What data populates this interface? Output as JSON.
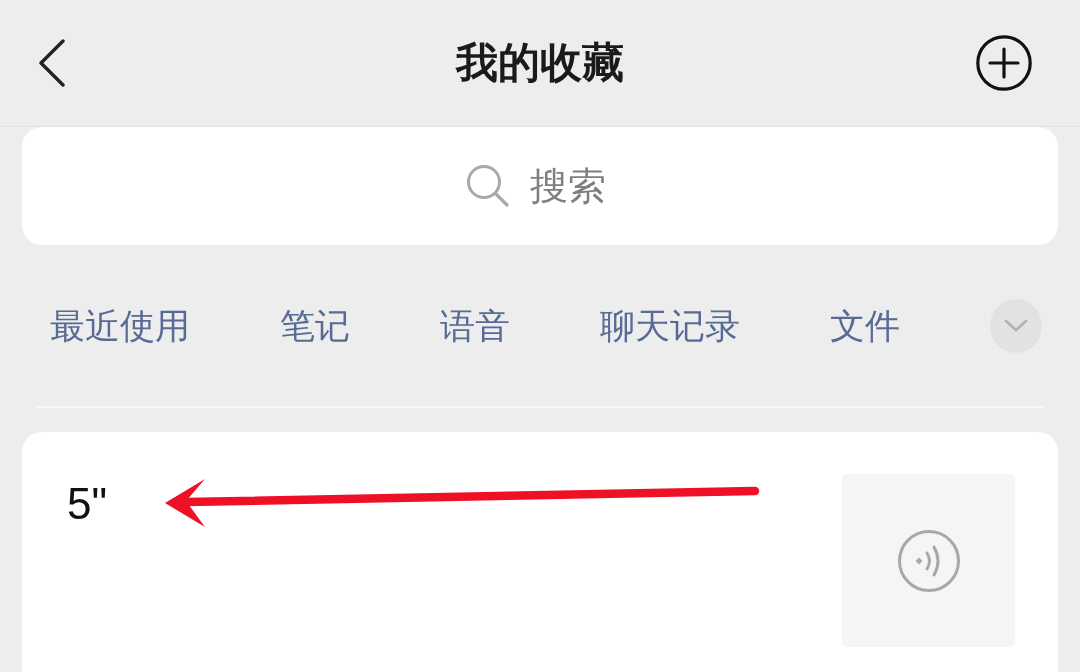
{
  "header": {
    "title": "我的收藏"
  },
  "search": {
    "placeholder": "搜索"
  },
  "categories": [
    {
      "label": "最近使用",
      "selected": false
    },
    {
      "label": "笔记",
      "selected": false
    },
    {
      "label": "语音",
      "selected": false
    },
    {
      "label": "聊天记录",
      "selected": false
    },
    {
      "label": "文件",
      "selected": false
    }
  ],
  "favorites": [
    {
      "kind": "voice",
      "duration": "5\""
    }
  ]
}
